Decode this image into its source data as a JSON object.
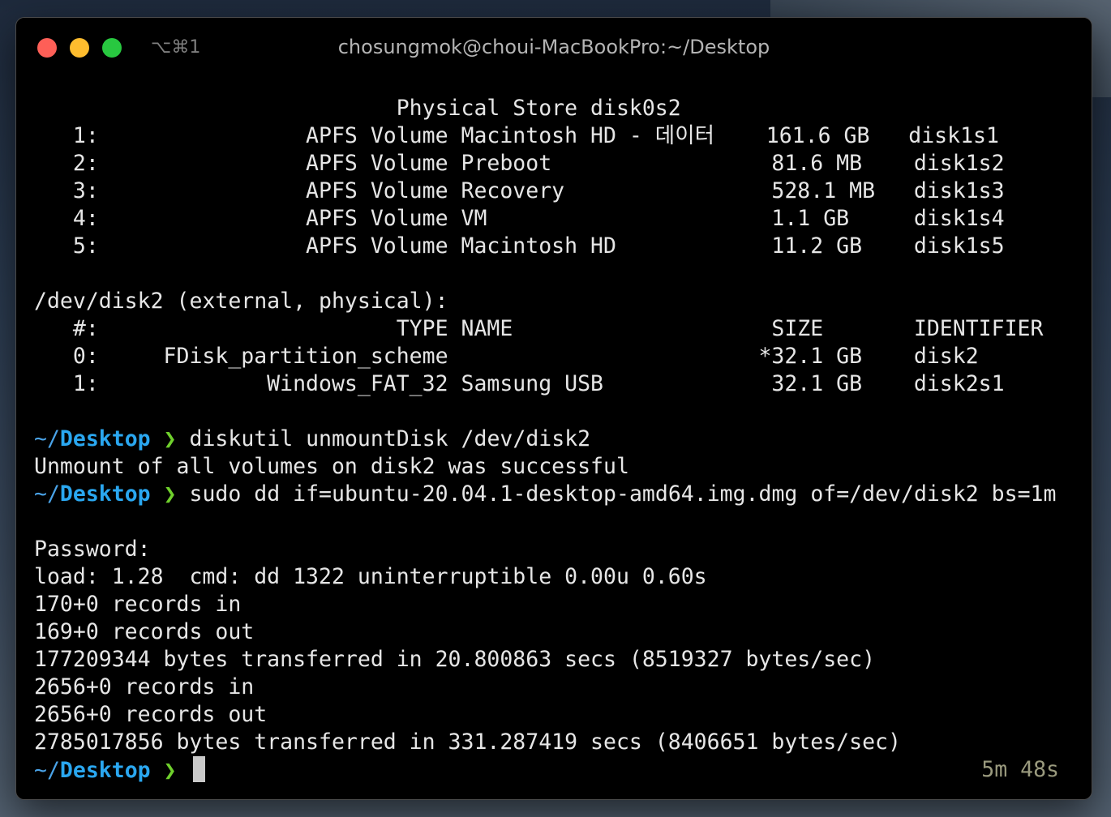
{
  "window": {
    "shortcut": "⌥⌘1",
    "title": "chosungmok@choui-MacBookPro:~/Desktop"
  },
  "lines": [
    {
      "type": "out",
      "text": "                            Physical Store disk0s2"
    },
    {
      "type": "out",
      "text": "   1:                APFS Volume Macintosh HD - 데이터    161.6 GB   disk1s1"
    },
    {
      "type": "out",
      "text": "   2:                APFS Volume Preboot                 81.6 MB    disk1s2"
    },
    {
      "type": "out",
      "text": "   3:                APFS Volume Recovery                528.1 MB   disk1s3"
    },
    {
      "type": "out",
      "text": "   4:                APFS Volume VM                      1.1 GB     disk1s4"
    },
    {
      "type": "out",
      "text": "   5:                APFS Volume Macintosh HD            11.2 GB    disk1s5"
    },
    {
      "type": "out",
      "text": ""
    },
    {
      "type": "out",
      "text": "/dev/disk2 (external, physical):"
    },
    {
      "type": "out",
      "text": "   #:                       TYPE NAME                    SIZE       IDENTIFIER"
    },
    {
      "type": "out",
      "text": "   0:     FDisk_partition_scheme                        *32.1 GB    disk2"
    },
    {
      "type": "out",
      "text": "   1:             Windows_FAT_32 Samsung USB             32.1 GB    disk2s1"
    },
    {
      "type": "out",
      "text": ""
    },
    {
      "type": "cmd",
      "tilde": "~/",
      "dir": "Desktop",
      "arrow": "❯",
      "text": "diskutil unmountDisk /dev/disk2"
    },
    {
      "type": "out",
      "text": "Unmount of all volumes on disk2 was successful"
    },
    {
      "type": "cmd",
      "tilde": "~/",
      "dir": "Desktop",
      "arrow": "❯",
      "text": "sudo dd if=ubuntu-20.04.1-desktop-amd64.img.dmg of=/dev/disk2 bs=1m"
    },
    {
      "type": "out",
      "text": ""
    },
    {
      "type": "out",
      "text": "Password:"
    },
    {
      "type": "out",
      "text": "load: 1.28  cmd: dd 1322 uninterruptible 0.00u 0.60s"
    },
    {
      "type": "out",
      "text": "170+0 records in"
    },
    {
      "type": "out",
      "text": "169+0 records out"
    },
    {
      "type": "out",
      "text": "177209344 bytes transferred in 20.800863 secs (8519327 bytes/sec)"
    },
    {
      "type": "out",
      "text": "2656+0 records in"
    },
    {
      "type": "out",
      "text": "2656+0 records out"
    },
    {
      "type": "out",
      "text": "2785017856 bytes transferred in 331.287419 secs (8406651 bytes/sec)"
    }
  ],
  "prompt": {
    "tilde": "~/",
    "dir": "Desktop",
    "arrow": "❯",
    "elapsed": "5m 48s"
  }
}
